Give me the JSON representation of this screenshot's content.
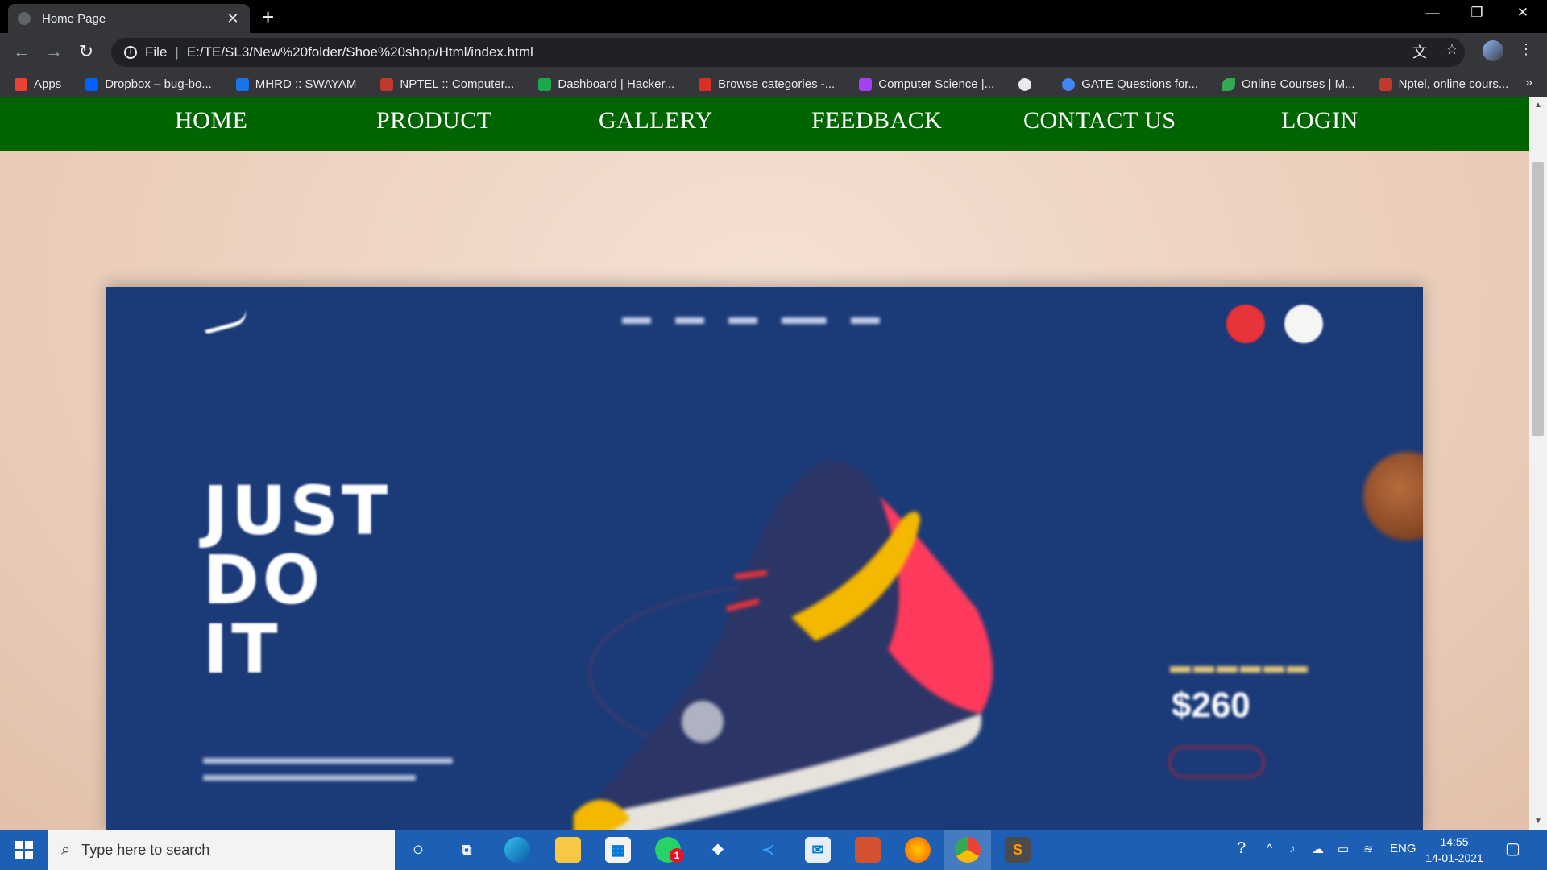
{
  "browser": {
    "tab_title": "Home Page",
    "address_protocol": "File",
    "address_url": "E:/TE/SL3/New%20folder/Shoe%20shop/Html/index.html",
    "bookmarks": [
      {
        "label": "Apps",
        "icon": "apps-grid-icon",
        "color": "#ea4335"
      },
      {
        "label": "Dropbox – bug-bo...",
        "icon": "dropbox-icon",
        "color": "#0061fe"
      },
      {
        "label": "MHRD :: SWAYAM",
        "icon": "swayam-icon",
        "color": "#1a73e8"
      },
      {
        "label": "NPTEL :: Computer...",
        "icon": "nptel-icon",
        "color": "#c0392b"
      },
      {
        "label": "Dashboard | Hacker...",
        "icon": "hackerrank-icon",
        "color": "#1ba94c"
      },
      {
        "label": "Browse categories -...",
        "icon": "categories-icon",
        "color": "#d93025"
      },
      {
        "label": "Computer Science |...",
        "icon": "geeks-icon",
        "color": "#a142f4"
      },
      {
        "label": "",
        "icon": "globe-icon",
        "color": "#e8eaed"
      },
      {
        "label": "GATE Questions for...",
        "icon": "gate-icon",
        "color": "#4285f4"
      },
      {
        "label": "Online Courses | M...",
        "icon": "leaf-icon",
        "color": "#34a853"
      },
      {
        "label": "Nptel, online cours...",
        "icon": "nptel-icon",
        "color": "#c0392b"
      }
    ],
    "bookmarks_more": "»"
  },
  "site": {
    "nav": [
      "HOME",
      "PRODUCT",
      "GALLERY",
      "FEEDBACK",
      "CONTACT US",
      "LOGIN"
    ],
    "nav_color": "#006400",
    "hero": {
      "headline": [
        "JUST",
        "DO",
        "IT"
      ],
      "price": "$260",
      "background": "#1b3a78"
    }
  },
  "taskbar": {
    "search_placeholder": "Type here to search",
    "language": "ENG",
    "time": "14:55",
    "date": "14-01-2021",
    "chat_badge": "1"
  }
}
